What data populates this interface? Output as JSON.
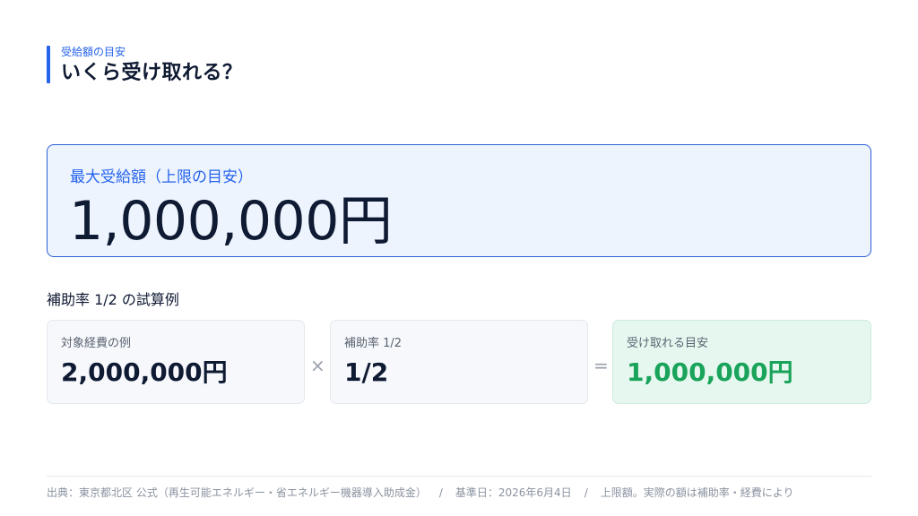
{
  "header": {
    "eyebrow": "受給額の目安",
    "title": "いくら受け取れる？"
  },
  "hero": {
    "label": "最大受給額（上限の目安）",
    "value": "1,000,000円"
  },
  "calc": {
    "section_title": "補助率 1/2 の試算例",
    "operator_times": "×",
    "operator_equals": "=",
    "cards": [
      {
        "label": "対象経費の例",
        "value": "2,000,000円"
      },
      {
        "label": "補助率 1/2",
        "value": "1/2"
      },
      {
        "label": "受け取れる目安",
        "value": "1,000,000円"
      }
    ]
  },
  "footer": {
    "source": "出典：東京都北区 公式（再生可能エネルギー・省エネルギー機器導入助成金）",
    "separator": "/",
    "reference_date": "基準日：2026年6月4日",
    "note": "上限額。実際の額は補助率・経費により"
  },
  "colors": {
    "accent": "#2563eb",
    "text": "#0f1a33",
    "result": "#1aa35a"
  }
}
